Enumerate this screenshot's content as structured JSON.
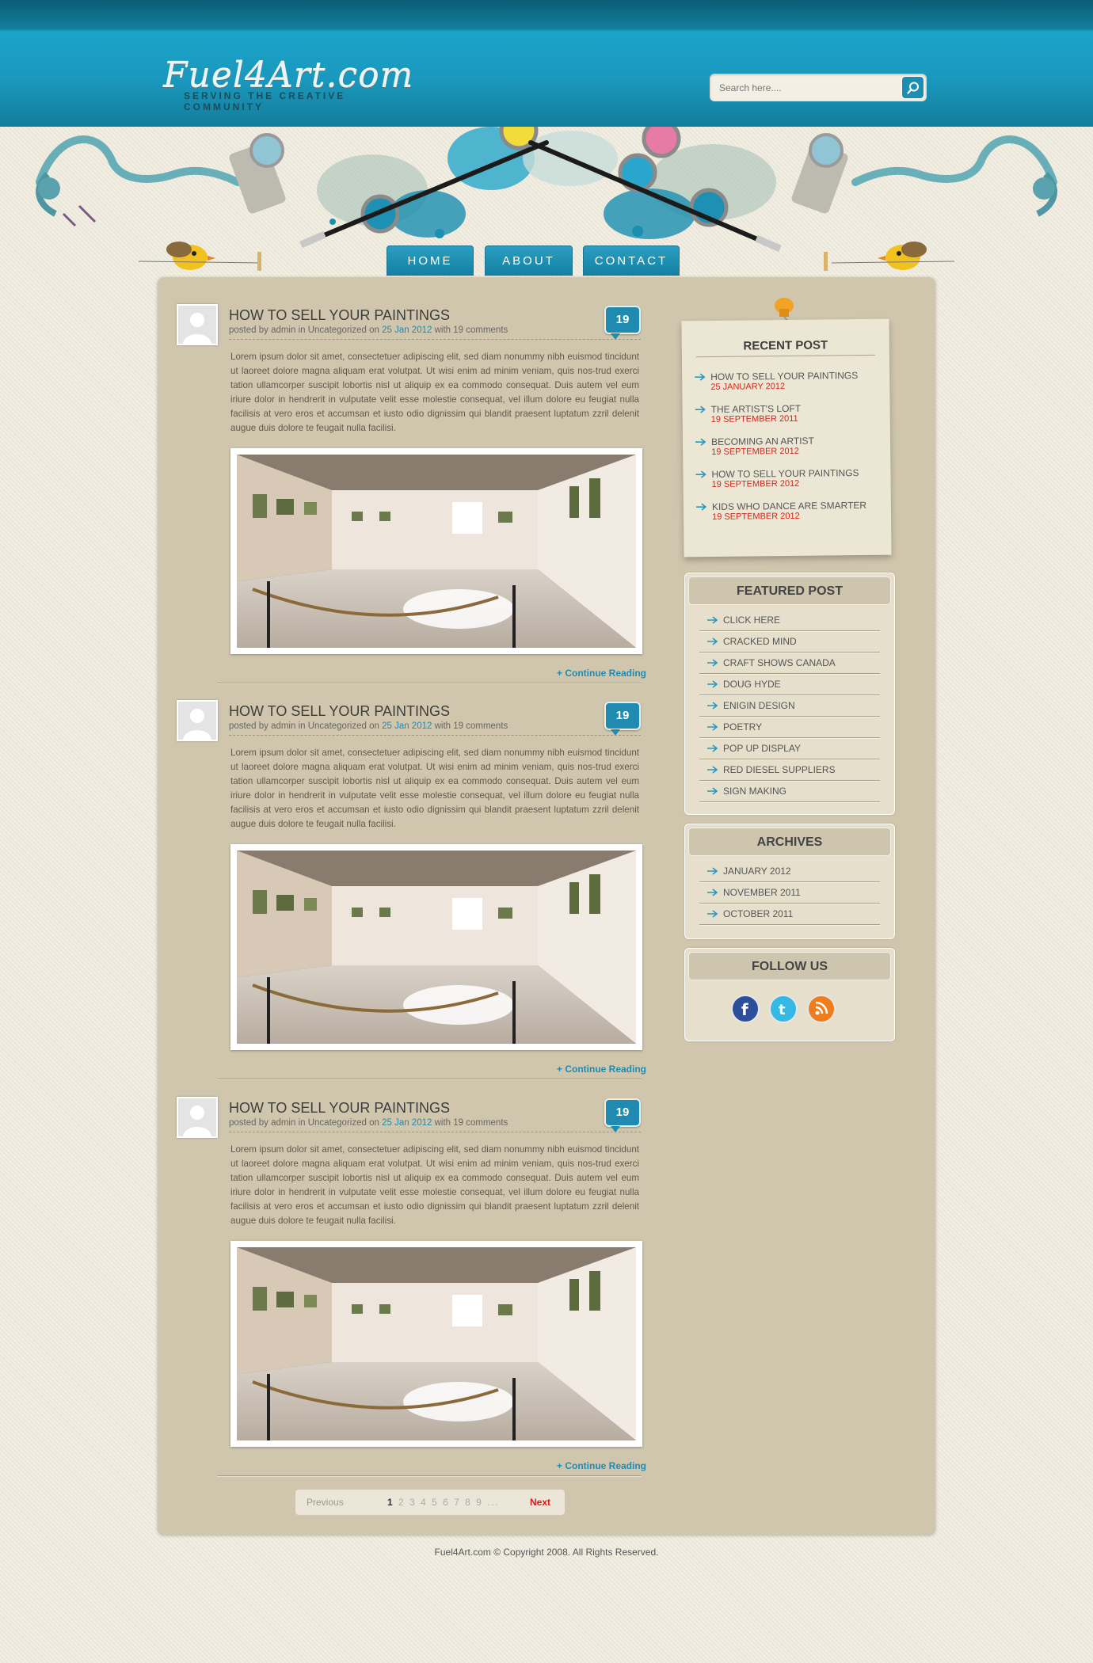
{
  "site": {
    "logo_title": "Fuel4Art.com",
    "logo_tagline": "SERVING THE CREATIVE COMMUNITY",
    "search_placeholder": "Search here...."
  },
  "nav": [
    {
      "label": "HOME"
    },
    {
      "label": "ABOUT"
    },
    {
      "label": "CONTACT"
    }
  ],
  "posts": [
    {
      "title": "HOW TO SELL YOUR PAINTINGS",
      "meta_prefix": "posted by admin in Uncategorized on",
      "date": "25 Jan 2012",
      "meta_suffix": "with 19 comments",
      "comments": "19",
      "body": "Lorem ipsum dolor sit amet, consectetuer adipiscing elit, sed diam nonummy nibh euismod tincidunt ut laoreet dolore magna aliquam erat volutpat. Ut wisi enim ad minim veniam, quis nos-trud exerci tation ullamcorper suscipit lobortis nisl ut aliquip ex ea commodo consequat. Duis autem vel eum iriure dolor in hendrerit in vulputate velit esse molestie consequat, vel illum dolore eu feugiat nulla facilisis at vero eros et accumsan et iusto odio dignissim qui blandit praesent luptatum zzril delenit augue duis dolore te feugait nulla facilisi.",
      "continue": "+ Continue Reading"
    },
    {
      "title": "HOW TO SELL YOUR PAINTINGS",
      "meta_prefix": "posted by admin in Uncategorized on",
      "date": "25 Jan 2012",
      "meta_suffix": "with 19 comments",
      "comments": "19",
      "body": "Lorem ipsum dolor sit amet, consectetuer adipiscing elit, sed diam nonummy nibh euismod tincidunt ut laoreet dolore magna aliquam erat volutpat. Ut wisi enim ad minim veniam, quis nos-trud exerci tation ullamcorper suscipit lobortis nisl ut aliquip ex ea commodo consequat. Duis autem vel eum iriure dolor in hendrerit in vulputate velit esse molestie consequat, vel illum dolore eu feugiat nulla facilisis at vero eros et accumsan et iusto odio dignissim qui blandit praesent luptatum zzril delenit augue duis dolore te feugait nulla facilisi.",
      "continue": "+ Continue Reading"
    },
    {
      "title": "HOW TO SELL YOUR PAINTINGS",
      "meta_prefix": "posted by admin in Uncategorized on",
      "date": "25 Jan 2012",
      "meta_suffix": "with 19 comments",
      "comments": "19",
      "body": "Lorem ipsum dolor sit amet, consectetuer adipiscing elit, sed diam nonummy nibh euismod tincidunt ut laoreet dolore magna aliquam erat volutpat. Ut wisi enim ad minim veniam, quis nos-trud exerci tation ullamcorper suscipit lobortis nisl ut aliquip ex ea commodo consequat. Duis autem vel eum iriure dolor in hendrerit in vulputate velit esse molestie consequat, vel illum dolore eu feugiat nulla facilisis at vero eros et accumsan et iusto odio dignissim qui blandit praesent luptatum zzril delenit augue duis dolore te feugait nulla facilisi.",
      "continue": "+ Continue Reading"
    }
  ],
  "pagination": {
    "previous": "Previous",
    "current": "1",
    "pages": "2 3 4 5 6 7 8 9 ...",
    "next": "Next"
  },
  "recent_post": {
    "heading": "RECENT POST",
    "items": [
      {
        "title": "HOW TO SELL YOUR PAINTINGS",
        "date": "25 JANUARY 2012"
      },
      {
        "title": "THE ARTIST'S LOFT",
        "date": "19 SEPTEMBER 2011"
      },
      {
        "title": "BECOMING AN ARTIST",
        "date": "19 SEPTEMBER 2012"
      },
      {
        "title": "HOW TO SELL YOUR PAINTINGS",
        "date": "19 SEPTEMBER 2012"
      },
      {
        "title": "KIDS WHO DANCE ARE SMARTER",
        "date": "19 SEPTEMBER 2012"
      }
    ]
  },
  "featured_post": {
    "heading": "FEATURED POST",
    "items": [
      "CLICK HERE",
      "CRACKED MIND",
      "CRAFT SHOWS CANADA",
      "DOUG HYDE",
      "ENIGIN DESIGN",
      "POETRY",
      "POP UP DISPLAY",
      "RED DIESEL SUPPLIERS",
      "SIGN MAKING"
    ]
  },
  "archives": {
    "heading": "ARCHIVES",
    "items": [
      "JANUARY 2012",
      "NOVEMBER 2011",
      "OCTOBER 2011"
    ]
  },
  "follow_us": {
    "heading": "FOLLOW US",
    "icons": [
      "facebook-icon",
      "twitter-icon",
      "rss-icon"
    ]
  },
  "footer": {
    "text": "Fuel4Art.com © Copyright 2008. All Rights Reserved."
  },
  "colors": {
    "accent": "#1f8bb0",
    "date_red": "#d5261b",
    "panel": "#cfc6ad"
  }
}
